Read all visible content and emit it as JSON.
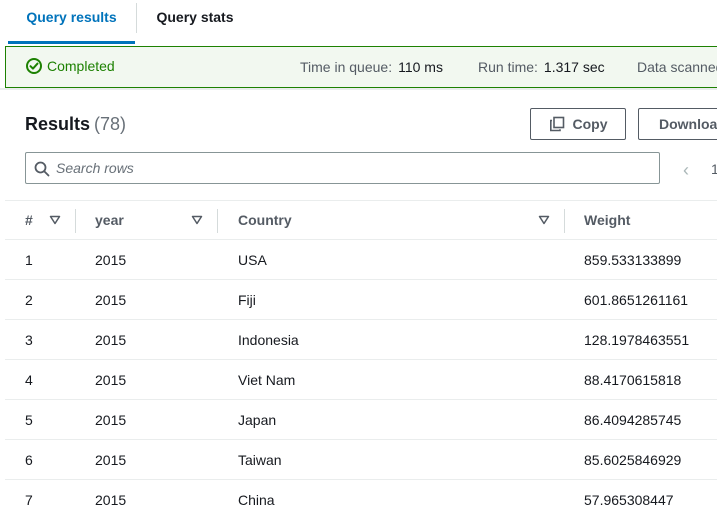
{
  "tabs": {
    "results_label": "Query results",
    "stats_label": "Query stats"
  },
  "status": {
    "state": "Completed",
    "queue_label": "Time in queue:",
    "queue_value": "110 ms",
    "runtime_label": "Run time:",
    "runtime_value": "1.317 sec",
    "scanned_label": "Data scanned"
  },
  "results": {
    "title": "Results",
    "count": "(78)",
    "copy_label": "Copy",
    "download_label": "Download",
    "search_placeholder": "Search rows",
    "pager_page": "1"
  },
  "table": {
    "columns": [
      "#",
      "year",
      "Country",
      "Weight"
    ],
    "rows": [
      {
        "n": "1",
        "year": "2015",
        "country": "USA",
        "weight": "859.533133899"
      },
      {
        "n": "2",
        "year": "2015",
        "country": "Fiji",
        "weight": "601.8651261161"
      },
      {
        "n": "3",
        "year": "2015",
        "country": "Indonesia",
        "weight": "128.1978463551"
      },
      {
        "n": "4",
        "year": "2015",
        "country": "Viet Nam",
        "weight": "88.4170615818"
      },
      {
        "n": "5",
        "year": "2015",
        "country": "Japan",
        "weight": "86.4094285745"
      },
      {
        "n": "6",
        "year": "2015",
        "country": "Taiwan",
        "weight": "85.6025846929"
      },
      {
        "n": "7",
        "year": "2015",
        "country": "China",
        "weight": "57.965308447"
      }
    ]
  },
  "colors": {
    "accent": "#0073bb",
    "success": "#1d8102",
    "success_bg": "#f2f8f0"
  },
  "icons": {
    "status": "check-circle-icon",
    "copy": "copy-icon",
    "search": "search-icon",
    "sort": "caret-down-icon",
    "prev": "chevron-left-icon"
  }
}
